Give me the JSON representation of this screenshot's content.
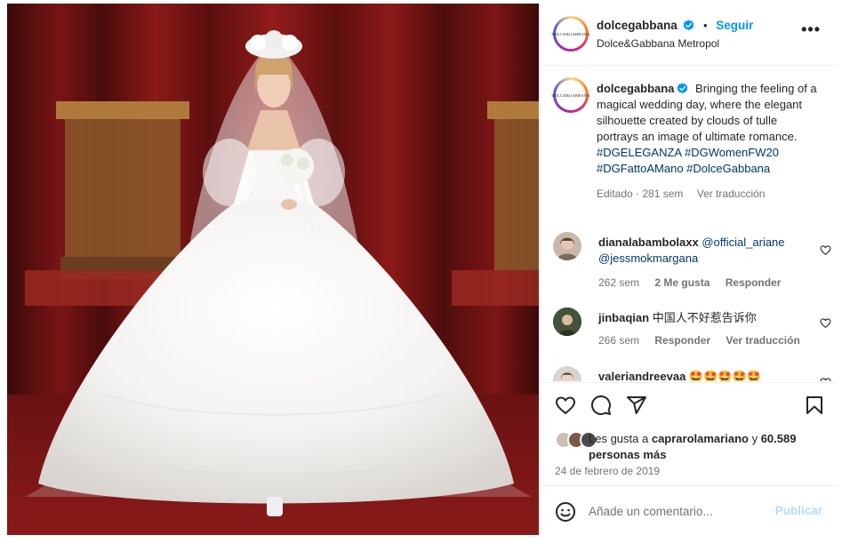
{
  "post": {
    "media_alt": "Model in white tulle bridal gown on runway",
    "account": {
      "username": "dolcegabbana",
      "avatar_text": "DOLCE&GABBANA",
      "verified": true,
      "follow_label": "Seguir",
      "separator": "•",
      "location": "Dolce&Gabbana Metropol"
    },
    "caption": {
      "username": "dolcegabbana",
      "text": "Bringing the feeling of a magical wedding day, where the elegant silhouette created by clouds of tulle portrays an image of ultimate romance.",
      "hashtags": [
        "#DGELEGANZA",
        "#DGWomenFW20",
        "#DGFattoAMano",
        "#DolceGabbana"
      ],
      "edited_label": "Editado",
      "time": "281 sem",
      "translate_label": "Ver traducción"
    },
    "comments": [
      {
        "username": "dianalabambolaxx",
        "text": "@official_ariane @jessmokmargana",
        "time": "262 sem",
        "likes": "2 Me gusta",
        "reply_label": "Responder",
        "translate_label": ""
      },
      {
        "username": "jinbaqian",
        "text": "中国人不好惹告诉你",
        "time": "266 sem",
        "likes": "",
        "reply_label": "Responder",
        "translate_label": "Ver traducción"
      },
      {
        "username": "valeriandreevaa",
        "text": "🤩🤩🤩🤩🤩",
        "time": "",
        "likes": "",
        "reply_label": "",
        "translate_label": ""
      }
    ],
    "likes": {
      "prefix": "Les gusta a",
      "user": "caprarolamariano",
      "conj": "y",
      "count": "60.589",
      "suffix": "personas más"
    },
    "date": "24 de febrero de 2019",
    "add_comment": {
      "placeholder": "Añade un comentario...",
      "publish_label": "Publicar"
    }
  },
  "icons": {
    "verified": "verified-badge-icon",
    "more": "more-options-icon",
    "heart": "heart-icon",
    "comment": "comment-icon",
    "share": "share-icon",
    "save": "bookmark-icon",
    "emoji": "emoji-icon"
  },
  "colors": {
    "link_blue": "#0095f6",
    "hashtag": "#00376b",
    "muted": "#737373",
    "publish_disabled": "#b3dbff",
    "verified": "#0095f6"
  }
}
